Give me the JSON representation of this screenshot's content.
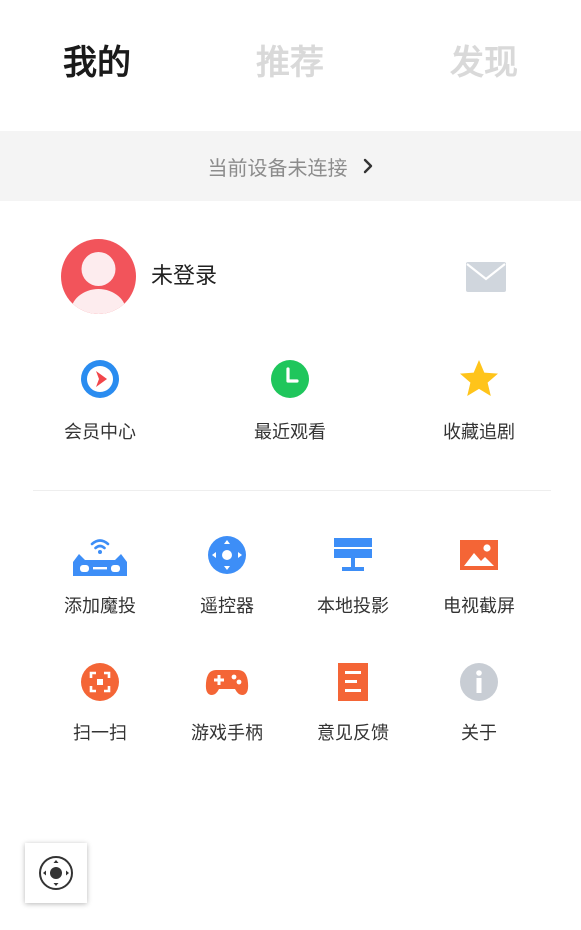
{
  "tabs": [
    {
      "label": "我的",
      "active": true
    },
    {
      "label": "推荐",
      "active": false
    },
    {
      "label": "发现",
      "active": false
    }
  ],
  "device_bar": {
    "text": "当前设备未连接",
    "icon": "chevron-right-icon"
  },
  "profile": {
    "login_text": "未登录",
    "avatar_icon": "user-avatar-icon",
    "message_icon": "mail-icon"
  },
  "features": [
    {
      "label": "会员中心",
      "icon": "vip-play-icon",
      "color": "#2a8cf0"
    },
    {
      "label": "最近观看",
      "icon": "clock-icon",
      "color": "#1fc65c"
    },
    {
      "label": "收藏追剧",
      "icon": "star-icon",
      "color": "#ffc41a"
    }
  ],
  "tools": [
    {
      "label": "添加魔投",
      "icon": "cast-device-icon",
      "color": "#3d8ef7"
    },
    {
      "label": "遥控器",
      "icon": "remote-dpad-icon",
      "color": "#3d8ef7"
    },
    {
      "label": "本地投影",
      "icon": "monitor-icon",
      "color": "#3d8ef7"
    },
    {
      "label": "电视截屏",
      "icon": "image-icon",
      "color": "#f46536"
    },
    {
      "label": "扫一扫",
      "icon": "scan-icon",
      "color": "#f46536"
    },
    {
      "label": "游戏手柄",
      "icon": "gamepad-icon",
      "color": "#f46536"
    },
    {
      "label": "意见反馈",
      "icon": "feedback-doc-icon",
      "color": "#f46536"
    },
    {
      "label": "关于",
      "icon": "info-icon",
      "color": "#c8cdd4"
    }
  ],
  "floating_button": {
    "icon": "assistive-touch-icon"
  },
  "colors": {
    "avatar_bg": "#f2545b",
    "device_bar_bg": "#f4f4f4",
    "inactive_tab": "#d9d9d9",
    "active_tab": "#1a1a1a"
  }
}
